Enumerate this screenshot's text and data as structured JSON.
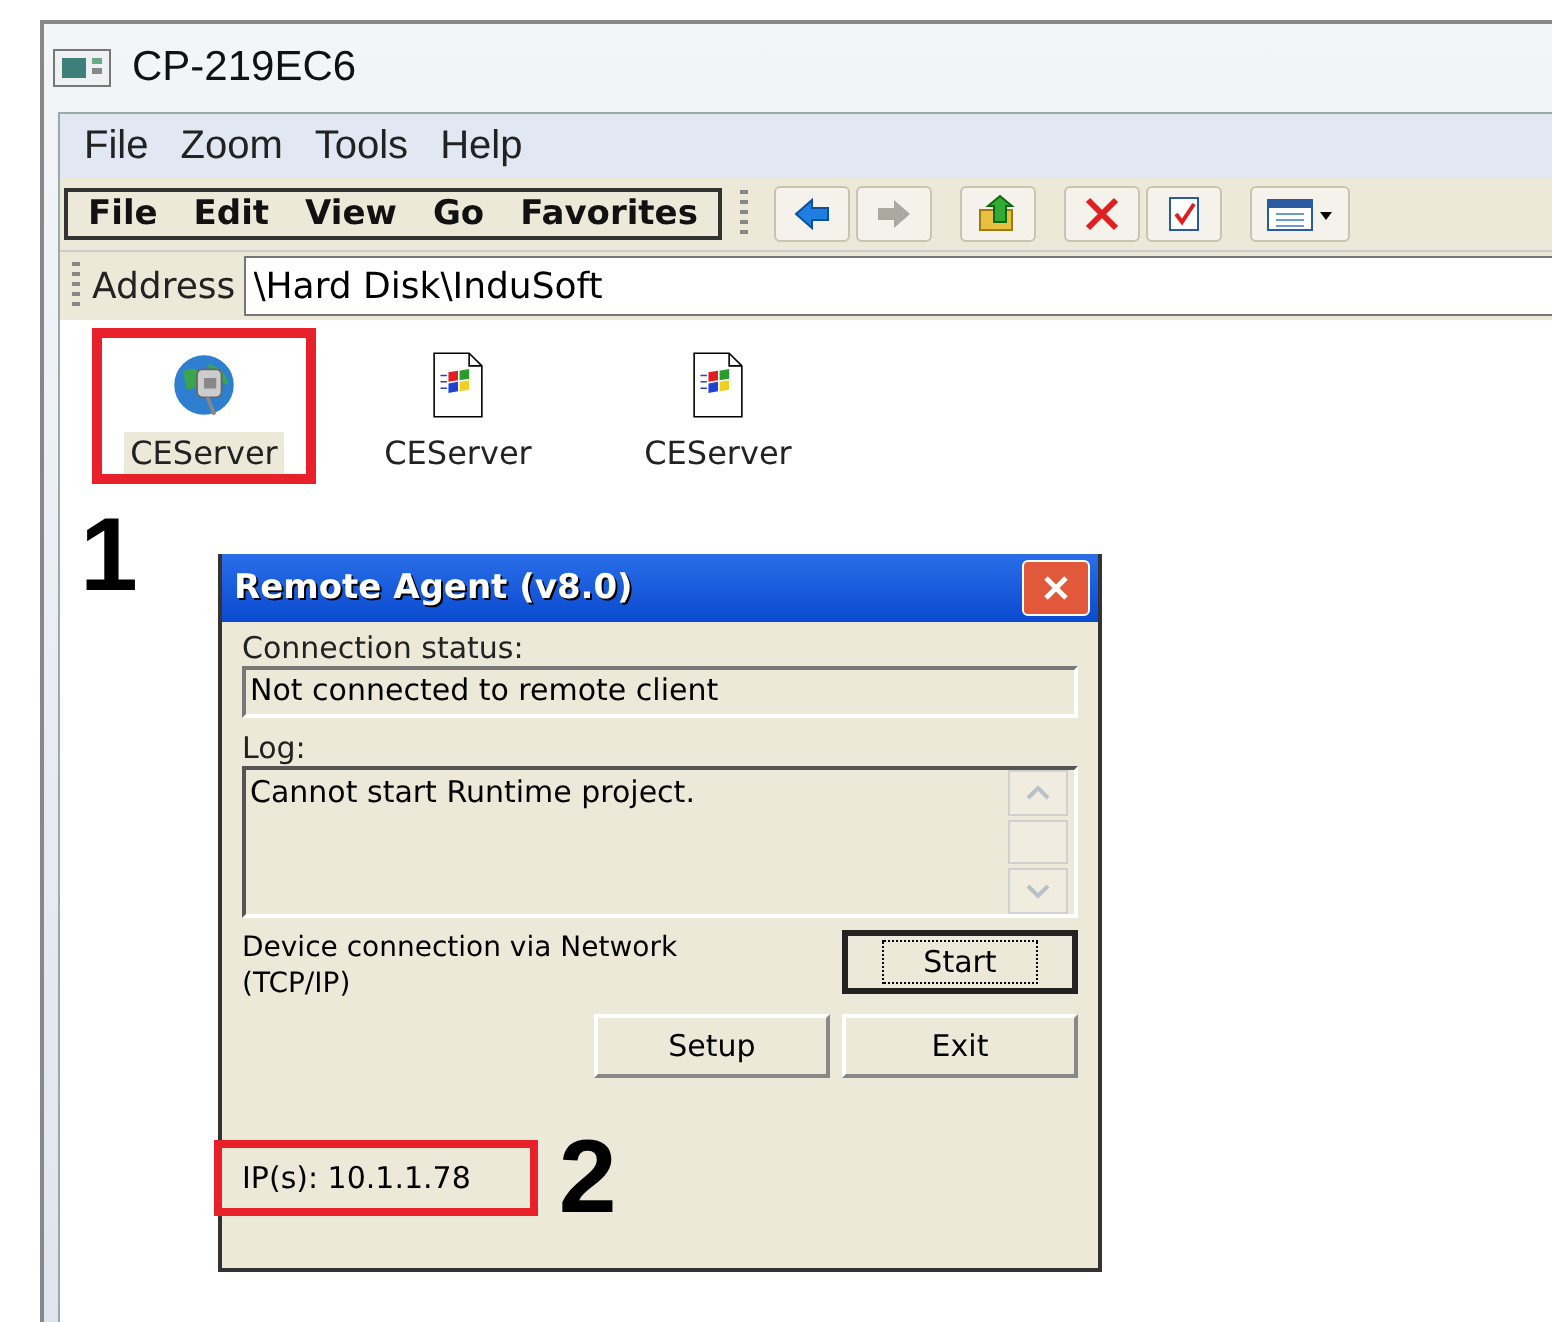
{
  "window": {
    "title": "CP-219EC6"
  },
  "menu_bar": [
    "File",
    "Zoom",
    "Tools",
    "Help"
  ],
  "command_bar": {
    "menus": [
      {
        "label": "File"
      },
      {
        "label": "Edit"
      },
      {
        "label": "View"
      },
      {
        "label": "Go"
      },
      {
        "label": "Favorites"
      }
    ],
    "tools": [
      {
        "kind": "back"
      },
      {
        "kind": "forward",
        "disabled": true
      },
      {
        "kind": "up"
      },
      {
        "kind": "delete"
      },
      {
        "kind": "properties"
      },
      {
        "kind": "views"
      }
    ]
  },
  "address": {
    "label": "Address",
    "value": "\\Hard Disk\\InduSoft"
  },
  "files": [
    {
      "name": "CEServer",
      "kind": "app",
      "selected": true,
      "highlighted": true
    },
    {
      "name": "CEServer",
      "kind": "doc",
      "selected": false,
      "highlighted": false
    },
    {
      "name": "CEServer",
      "kind": "doc",
      "selected": false,
      "highlighted": false
    }
  ],
  "annotations": {
    "first": "1",
    "second": "2"
  },
  "dialog": {
    "title": "Remote Agent (v8.0)",
    "status_label": "Connection status:",
    "status": "Not connected to remote client",
    "log_label": "Log:",
    "log": "Cannot start Runtime project.",
    "connection": "Device connection via Network (TCP/IP)",
    "buttons": [
      {
        "label": "Start",
        "focused": true
      },
      {
        "label": "Setup",
        "focused": false
      },
      {
        "label": "Exit",
        "focused": false
      }
    ],
    "ip": "IP(s): 10.1.1.78",
    "ip_highlighted": true
  }
}
